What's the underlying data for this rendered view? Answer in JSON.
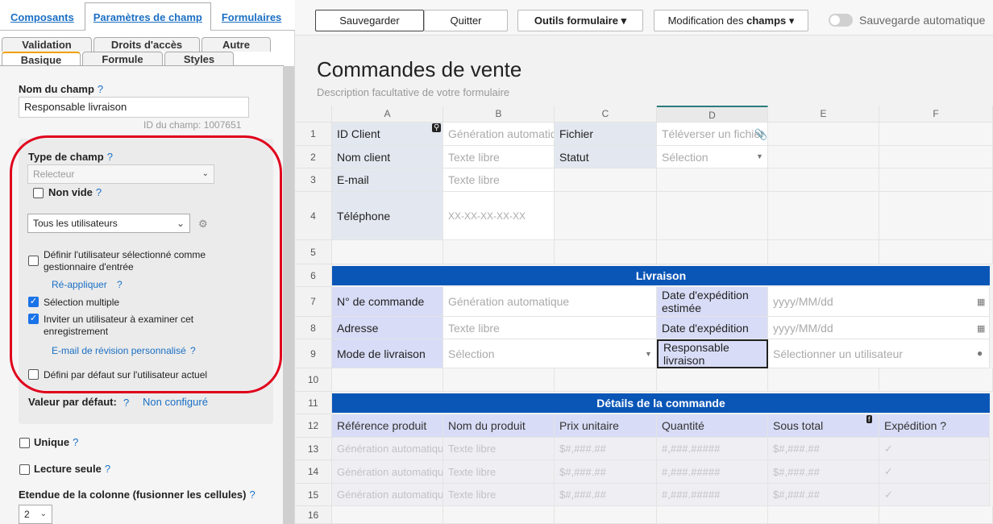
{
  "main_tabs": [
    "Composants",
    "Paramètres de champ",
    "Formulaires"
  ],
  "sub_tabs_top": [
    "Validation",
    "Droits d'accès",
    "Autre"
  ],
  "sub_tabs_bottom": [
    "Basique",
    "Formule",
    "Styles"
  ],
  "field": {
    "name_label": "Nom du champ",
    "help": "?",
    "name_value": "Responsable livraison",
    "id_text": "ID du champ: 1007651",
    "type_label": "Type de champ",
    "type_value": "Relecteur",
    "not_empty": "Non vide",
    "users_select": "Tous les utilisateurs",
    "set_manager": "Définir l'utilisateur sélectionné comme gestionnaire d'entrée",
    "reapply": "Ré-appliquer",
    "multi_select": "Sélection multiple",
    "invite": "Inviter un utilisateur à examiner cet enregistrement",
    "custom_email": "E-mail de révision personnalisé",
    "default_current": "Défini par défaut sur l'utilisateur actuel",
    "default_value_label": "Valeur par défaut:",
    "default_value": "Non configuré",
    "unique": "Unique",
    "readonly": "Lecture seule",
    "colspan_label": "Etendue de la colonne (fusionner les cellules)",
    "colspan_value": "2"
  },
  "toolbar": {
    "save": "Sauvegarder",
    "quit": "Quitter",
    "form_tools": "Outils formulaire",
    "edit_prefix": "Modification des",
    "edit_bold": "champs",
    "autosave": "Sauvegarde automatique"
  },
  "form": {
    "title": "Commandes de vente",
    "description": "Description facultative de votre formulaire"
  },
  "columns": [
    "A",
    "B",
    "C",
    "D",
    "E",
    "F"
  ],
  "rows": [
    "1",
    "2",
    "3",
    "4",
    "5",
    "6",
    "7",
    "8",
    "9",
    "10",
    "11",
    "12",
    "13",
    "14",
    "15",
    "16"
  ],
  "cells": {
    "r1": [
      "ID Client",
      "Génération automatique",
      "Fichier",
      "Téléverser un fichier"
    ],
    "r2": [
      "Nom client",
      "Texte libre",
      "Statut",
      "Sélection"
    ],
    "r3": [
      "E-mail",
      "Texte libre"
    ],
    "r4": [
      "Téléphone",
      "XX-XX-XX-XX-XX"
    ],
    "livraison": "Livraison",
    "r7": [
      "N° de commande",
      "Génération automatique",
      "Date d'expédition estimée",
      "yyyy/MM/dd"
    ],
    "r8": [
      "Adresse",
      "Texte libre",
      "Date d'expédition",
      "yyyy/MM/dd"
    ],
    "r9": [
      "Mode de livraison",
      "Sélection",
      "Responsable livraison",
      "Sélectionner un utilisateur"
    ],
    "details": "Détails de la commande",
    "r12": [
      "Référence produit",
      "Nom du produit",
      "Prix unitaire",
      "Quantité",
      "Sous total",
      "Expédition ?"
    ],
    "ghost": [
      "Génération automatique",
      "Texte libre",
      "$#,###.##",
      "#,###.#####",
      "$#,###.##",
      "✓"
    ]
  }
}
